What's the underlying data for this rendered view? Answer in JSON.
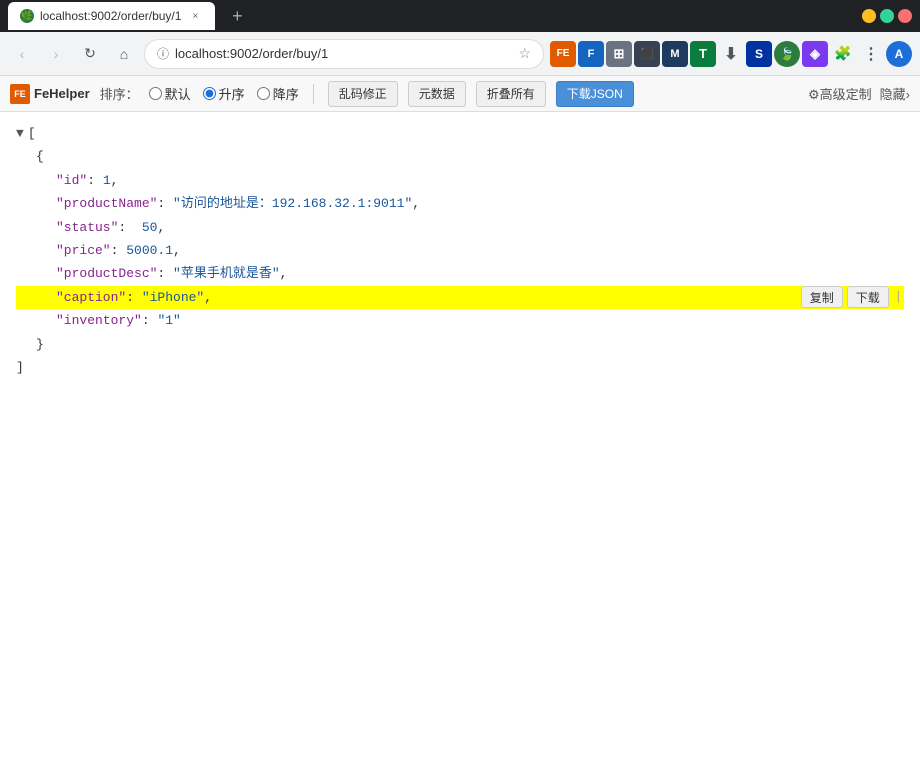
{
  "titlebar": {
    "favicon_text": "🌿",
    "tab_title": "localhost:9002/order/buy/1",
    "close_label": "×",
    "new_tab_label": "+",
    "controls": {
      "minimize": "—",
      "maximize": "□",
      "close": "✕"
    }
  },
  "addressbar": {
    "url": "localhost:9002/order/buy/1",
    "star_icon": "☆",
    "nav": {
      "back": "‹",
      "forward": "›",
      "refresh": "↻",
      "home": "⌂"
    },
    "toolbar_icons": [
      {
        "id": "fe",
        "label": "FE",
        "class": "ti-fe"
      },
      {
        "id": "blue",
        "label": "F",
        "class": "ti-blue"
      },
      {
        "id": "gray",
        "label": "⊞",
        "class": "ti-gray"
      },
      {
        "id": "dark",
        "label": "⬛",
        "class": "ti-dark"
      },
      {
        "id": "green2",
        "label": "M",
        "class": "ti-green2"
      },
      {
        "id": "teal",
        "label": "T",
        "class": "ti-teal"
      },
      {
        "id": "dl",
        "label": "⬇",
        "class": "ti-dl"
      },
      {
        "id": "s",
        "label": "S",
        "class": "ti-s"
      },
      {
        "id": "leaf",
        "label": "🍃",
        "class": "ti-leaf"
      },
      {
        "id": "purple",
        "label": "◈",
        "class": "ti-purple"
      },
      {
        "id": "star2",
        "label": "✩",
        "class": "ti-star2"
      },
      {
        "id": "dots",
        "label": "⋮",
        "class": "ti-dots"
      },
      {
        "id": "avatar",
        "label": "A",
        "class": "ti-avatar"
      }
    ]
  },
  "fehelper": {
    "logo_text": "FE",
    "app_name": "FeHelper",
    "sort_label": "排序：",
    "radio_options": [
      {
        "label": "默认",
        "value": "default",
        "checked": false
      },
      {
        "label": "升序",
        "value": "asc",
        "checked": true
      },
      {
        "label": "降序",
        "value": "desc",
        "checked": false
      }
    ],
    "buttons": [
      {
        "id": "fix-encoding",
        "label": "乱码修正"
      },
      {
        "id": "raw-data",
        "label": "元数据"
      },
      {
        "id": "collapse-all",
        "label": "折叠所有"
      },
      {
        "id": "download-json",
        "label": "下载JSON",
        "primary": true
      }
    ],
    "settings_label": "⚙高级定制",
    "hide_label": "隐藏›"
  },
  "json_content": {
    "lines": [
      {
        "indent": 0,
        "toggle": "▼",
        "content": "[",
        "type": "bracket"
      },
      {
        "indent": 1,
        "content": "{",
        "type": "bracket"
      },
      {
        "indent": 2,
        "key": "id",
        "colon": ": ",
        "value": "1",
        "value_type": "number",
        "comma": ","
      },
      {
        "indent": 2,
        "key": "productName",
        "colon": ": ",
        "value": "\"访问的地址是：192.168.32.1:9011\"",
        "value_type": "string",
        "comma": ","
      },
      {
        "indent": 2,
        "key": "status",
        "colon": ":  ",
        "value": "50",
        "value_type": "number",
        "comma": ","
      },
      {
        "indent": 2,
        "key": "price",
        "colon": ": ",
        "value": "5000.1",
        "value_type": "number",
        "comma": ","
      },
      {
        "indent": 2,
        "key": "productDesc",
        "colon": ": ",
        "value": "\"苹果手机就是香\"",
        "value_type": "string",
        "comma": ","
      },
      {
        "indent": 2,
        "key": "caption",
        "colon": ": ",
        "value": "\"iPhone\"",
        "value_type": "string",
        "comma": ",",
        "highlighted": true,
        "actions": [
          "复制",
          "下载",
          "|"
        ]
      },
      {
        "indent": 2,
        "key": "inventory",
        "colon": ": ",
        "value": "\"1\"",
        "value_type": "string"
      },
      {
        "indent": 1,
        "content": "}",
        "type": "bracket"
      },
      {
        "indent": 0,
        "content": "]",
        "type": "bracket"
      }
    ]
  }
}
